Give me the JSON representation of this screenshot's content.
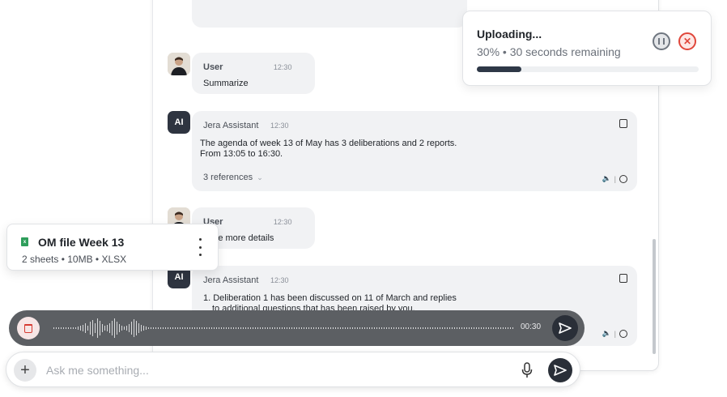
{
  "upload": {
    "title": "Uploading...",
    "meta": "30%  • 30 seconds remaining",
    "progress": 0.2
  },
  "messages": [
    {
      "sender": "User",
      "time": "12:30",
      "text": "Summarize"
    },
    {
      "avatar": "AI",
      "sender": "Jera Assistant",
      "time": "12:30",
      "text_line1": "The agenda of week 13 of May has 3 deliberations and 2 reports.",
      "text_line2": "From 13:05 to 16:30.",
      "references": "3 references"
    },
    {
      "sender": "User",
      "time": "12:30",
      "text": "e me more details"
    },
    {
      "avatar": "AI",
      "sender": "Jera Assistant",
      "time": "12:30",
      "text_line1": "1. Deliberation 1 has been discussed on 11 of March and replies",
      "text_line2": "to additional questions that has been raised by you."
    }
  ],
  "file": {
    "name": "OM file Week 13",
    "meta": "2 sheets  •  10MB  •  XLSX"
  },
  "voice": {
    "duration": "00:30"
  },
  "composer": {
    "placeholder": "Ask me something..."
  },
  "colors": {
    "accent_dark": "#2a2f38",
    "danger": "#e0463a",
    "bubble": "#f1f2f4"
  }
}
